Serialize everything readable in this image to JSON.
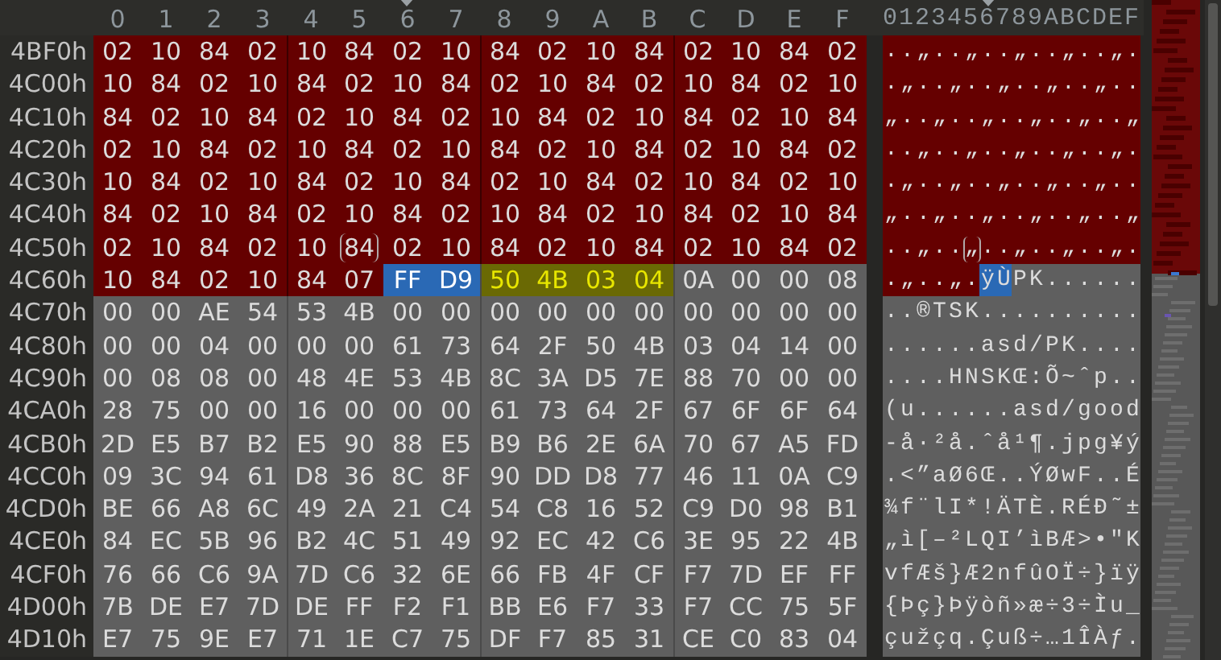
{
  "header": {
    "columns": [
      {
        "label": "0",
        "pointer": false
      },
      {
        "label": "1",
        "pointer": false
      },
      {
        "label": "2",
        "pointer": false
      },
      {
        "label": "3",
        "pointer": false
      },
      {
        "label": "4",
        "pointer": false
      },
      {
        "label": "5",
        "pointer": false
      },
      {
        "label": "6",
        "pointer": true
      },
      {
        "label": "7",
        "pointer": false
      },
      {
        "label": "8",
        "pointer": false
      },
      {
        "label": "9",
        "pointer": false
      },
      {
        "label": "A",
        "pointer": false
      },
      {
        "label": "B",
        "pointer": false
      },
      {
        "label": "C",
        "pointer": false
      },
      {
        "label": "D",
        "pointer": false
      },
      {
        "label": "E",
        "pointer": false
      },
      {
        "label": "F",
        "pointer": false
      }
    ],
    "text_header": "0123456789ABCDEF"
  },
  "rows": [
    {
      "address": "4BF0h",
      "kind": "marked",
      "bytes": [
        "02",
        "10",
        "84",
        "02",
        "10",
        "84",
        "02",
        "10",
        "84",
        "02",
        "10",
        "84",
        "02",
        "10",
        "84",
        "02"
      ],
      "text": "..„..„..„..„..„."
    },
    {
      "address": "4C00h",
      "kind": "marked",
      "bytes": [
        "10",
        "84",
        "02",
        "10",
        "84",
        "02",
        "10",
        "84",
        "02",
        "10",
        "84",
        "02",
        "10",
        "84",
        "02",
        "10"
      ],
      "text": ".„..„..„..„..„.."
    },
    {
      "address": "4C10h",
      "kind": "marked",
      "bytes": [
        "84",
        "02",
        "10",
        "84",
        "02",
        "10",
        "84",
        "02",
        "10",
        "84",
        "02",
        "10",
        "84",
        "02",
        "10",
        "84"
      ],
      "text": "„..„..„..„..„..„"
    },
    {
      "address": "4C20h",
      "kind": "marked",
      "bytes": [
        "02",
        "10",
        "84",
        "02",
        "10",
        "84",
        "02",
        "10",
        "84",
        "02",
        "10",
        "84",
        "02",
        "10",
        "84",
        "02"
      ],
      "text": "..„..„..„..„..„."
    },
    {
      "address": "4C30h",
      "kind": "marked",
      "bytes": [
        "10",
        "84",
        "02",
        "10",
        "84",
        "02",
        "10",
        "84",
        "02",
        "10",
        "84",
        "02",
        "10",
        "84",
        "02",
        "10"
      ],
      "text": ".„..„..„..„..„.."
    },
    {
      "address": "4C40h",
      "kind": "marked",
      "bytes": [
        "84",
        "02",
        "10",
        "84",
        "02",
        "10",
        "84",
        "02",
        "10",
        "84",
        "02",
        "10",
        "84",
        "02",
        "10",
        "84"
      ],
      "text": "„..„..„..„..„..„"
    },
    {
      "address": "4C50h",
      "bytes": [
        {
          "value": "02",
          "kind": "marked"
        },
        {
          "value": "10",
          "kind": "marked"
        },
        {
          "value": "84",
          "kind": "marked"
        },
        {
          "value": "02",
          "kind": "marked"
        },
        {
          "value": "10",
          "kind": "marked"
        },
        {
          "value": "84",
          "kind": "cursor"
        },
        {
          "value": "02",
          "kind": "marked"
        },
        {
          "value": "10",
          "kind": "marked"
        },
        {
          "value": "84",
          "kind": "marked"
        },
        {
          "value": "02",
          "kind": "marked"
        },
        {
          "value": "10",
          "kind": "marked"
        },
        {
          "value": "84",
          "kind": "marked"
        },
        {
          "value": "02",
          "kind": "marked"
        },
        {
          "value": "10",
          "kind": "marked"
        },
        {
          "value": "84",
          "kind": "marked"
        },
        {
          "value": "02",
          "kind": "marked"
        }
      ],
      "text": "..„..„..„..„..„."
    },
    {
      "address": "4C60h",
      "bytes": [
        {
          "value": "10",
          "kind": "marked"
        },
        {
          "value": "84",
          "kind": "marked"
        },
        {
          "value": "02",
          "kind": "marked"
        },
        {
          "value": "10",
          "kind": "marked"
        },
        {
          "value": "84",
          "kind": "marked"
        },
        {
          "value": "07",
          "kind": "marked"
        },
        {
          "value": "FF",
          "kind": "selected"
        },
        {
          "value": "D9",
          "kind": "selected"
        },
        {
          "value": "50",
          "kind": "match"
        },
        {
          "value": "4B",
          "kind": "match"
        },
        {
          "value": "03",
          "kind": "match"
        },
        {
          "value": "04",
          "kind": "match"
        },
        {
          "value": "0A",
          "kind": "plain"
        },
        {
          "value": "00",
          "kind": "plain"
        },
        {
          "value": "00",
          "kind": "plain"
        },
        {
          "value": "08",
          "kind": "plain"
        }
      ],
      "text": ".„..„.ÿÙPK......"
    },
    {
      "address": "4C70h",
      "kind": "plain",
      "bytes": [
        "00",
        "00",
        "AE",
        "54",
        "53",
        "4B",
        "00",
        "00",
        "00",
        "00",
        "00",
        "00",
        "00",
        "00",
        "00",
        "00"
      ],
      "text": "..®TSK.........."
    },
    {
      "address": "4C80h",
      "kind": "plain",
      "bytes": [
        "00",
        "00",
        "04",
        "00",
        "00",
        "00",
        "61",
        "73",
        "64",
        "2F",
        "50",
        "4B",
        "03",
        "04",
        "14",
        "00"
      ],
      "text": "......asd/PK...."
    },
    {
      "address": "4C90h",
      "kind": "plain",
      "bytes": [
        "00",
        "08",
        "08",
        "00",
        "48",
        "4E",
        "53",
        "4B",
        "8C",
        "3A",
        "D5",
        "7E",
        "88",
        "70",
        "00",
        "00"
      ],
      "text": "....HNSKŒ:Õ~ˆp.."
    },
    {
      "address": "4CA0h",
      "kind": "plain",
      "bytes": [
        "28",
        "75",
        "00",
        "00",
        "16",
        "00",
        "00",
        "00",
        "61",
        "73",
        "64",
        "2F",
        "67",
        "6F",
        "6F",
        "64"
      ],
      "text": "(u......asd/good"
    },
    {
      "address": "4CB0h",
      "kind": "plain",
      "bytes": [
        "2D",
        "E5",
        "B7",
        "B2",
        "E5",
        "90",
        "88",
        "E5",
        "B9",
        "B6",
        "2E",
        "6A",
        "70",
        "67",
        "A5",
        "FD"
      ],
      "text": "-å·²å.ˆå¹¶.jpg¥ý"
    },
    {
      "address": "4CC0h",
      "kind": "plain",
      "bytes": [
        "09",
        "3C",
        "94",
        "61",
        "D8",
        "36",
        "8C",
        "8F",
        "90",
        "DD",
        "D8",
        "77",
        "46",
        "11",
        "0A",
        "C9"
      ],
      "text": ".<”aØ6Œ..ÝØwF..É"
    },
    {
      "address": "4CD0h",
      "kind": "plain",
      "bytes": [
        "BE",
        "66",
        "A8",
        "6C",
        "49",
        "2A",
        "21",
        "C4",
        "54",
        "C8",
        "16",
        "52",
        "C9",
        "D0",
        "98",
        "B1"
      ],
      "text": "¾f¨lI*!ÄTÈ.RÉÐ˜±"
    },
    {
      "address": "4CE0h",
      "kind": "plain",
      "bytes": [
        "84",
        "EC",
        "5B",
        "96",
        "B2",
        "4C",
        "51",
        "49",
        "92",
        "EC",
        "42",
        "C6",
        "3E",
        "95",
        "22",
        "4B"
      ],
      "text": "„ì[–²LQI’ìBÆ>•\"K"
    },
    {
      "address": "4CF0h",
      "kind": "plain",
      "bytes": [
        "76",
        "66",
        "C6",
        "9A",
        "7D",
        "C6",
        "32",
        "6E",
        "66",
        "FB",
        "4F",
        "CF",
        "F7",
        "7D",
        "EF",
        "FF"
      ],
      "text": "vfÆš}Æ2nfûOÏ÷}ïÿ"
    },
    {
      "address": "4D00h",
      "kind": "plain",
      "bytes": [
        "7B",
        "DE",
        "E7",
        "7D",
        "DE",
        "FF",
        "F2",
        "F1",
        "BB",
        "E6",
        "F7",
        "33",
        "F7",
        "CC",
        "75",
        "5F"
      ],
      "text": "{Þç}Þÿòñ»æ÷3÷Ìu_"
    },
    {
      "address": "4D10h",
      "kind": "plain",
      "bytes": [
        "E7",
        "75",
        "9E",
        "E7",
        "71",
        "1E",
        "C7",
        "75",
        "DF",
        "F7",
        "85",
        "31",
        "CE",
        "C0",
        "83",
        "04"
      ],
      "text": "çužçq.Çuß÷…1ÎÀƒ."
    }
  ]
}
